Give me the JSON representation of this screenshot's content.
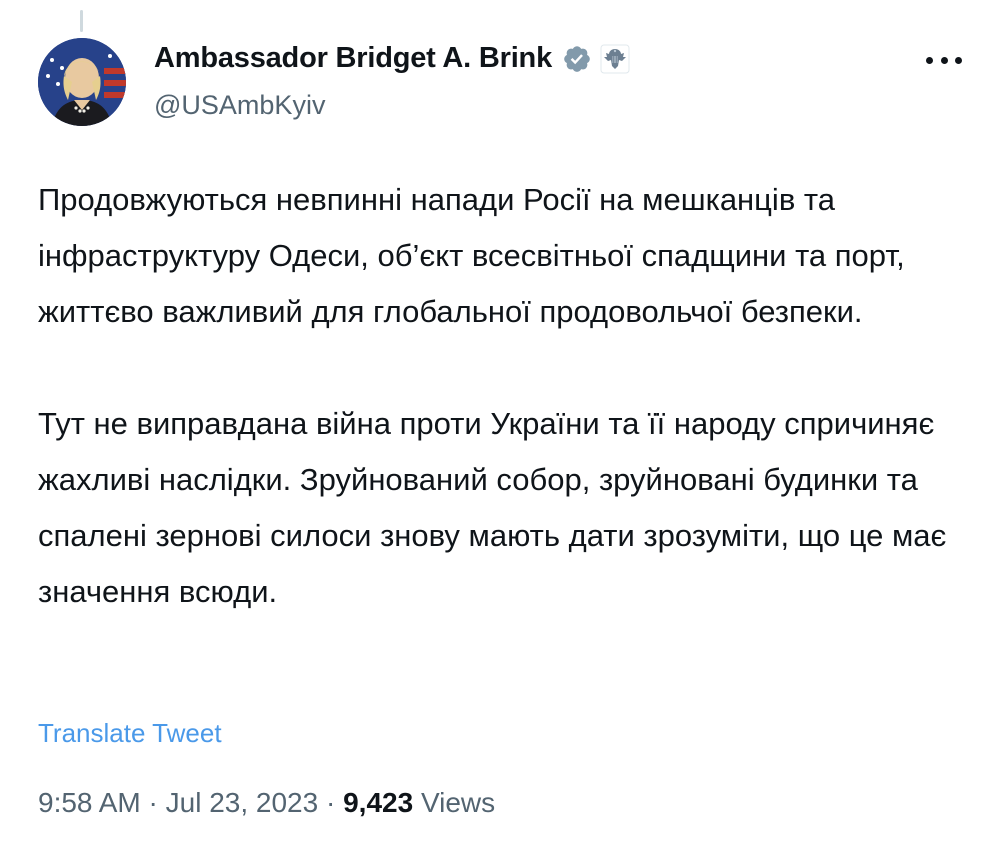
{
  "author": {
    "name": "Ambassador Bridget A. Brink",
    "handle": "@USAmbKyiv",
    "avatar_icon": "user-avatar",
    "verified_icon": "verified-badge-icon",
    "affiliation_icon": "us-state-department-seal-icon",
    "verified_color": "#829aab"
  },
  "tweet": {
    "paragraphs": [
      "Продовжуються невпинні напади Росії на мешканців та інфраструктуру Одеси, об’єкт всесвітньої спадщини та порт, життєво важливий для глобальної продовольчої безпеки.",
      "Тут не виправдана війна проти України та її народу спричиняє жахливі наслідки. Зруйнований собор, зруйновані будинки та спалені зернові силоси знову мають дати зрозуміти, що це має значення всюди."
    ],
    "translate_label": "Translate Tweet",
    "translate_color": "#4a99e9"
  },
  "meta": {
    "time": "9:58 AM",
    "separator": "·",
    "date": "Jul 23, 2023",
    "views_count": "9,423",
    "views_label": "Views"
  },
  "more_menu_icon": "more-horizontal-icon"
}
